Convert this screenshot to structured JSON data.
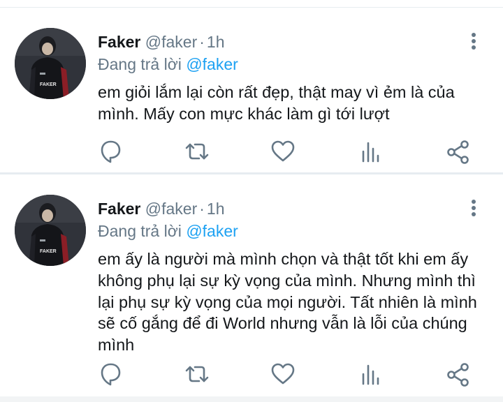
{
  "colors": {
    "name_text": "#14171a",
    "secondary_text": "#657786",
    "mention": "#1da1f2",
    "icon": "#657786",
    "divider": "#e6ecf0"
  },
  "tweets": [
    {
      "display_name": "Faker",
      "handle": "@faker",
      "separator_dot": "·",
      "time": "1h",
      "reply_prefix": "Đang trả lời ",
      "reply_to": "@faker",
      "text": "em giỏi lắm lại còn rất đẹp, thật may vì ẻm là của mình. Mấy con mực khác làm gì tới lượt",
      "avatar_jersey_text": "FAKER",
      "icons": {
        "avatar": "profile-avatar",
        "more": "more-vertical-icon",
        "reply": "reply-icon",
        "retweet": "retweet-icon",
        "like": "heart-icon",
        "stats": "analytics-icon",
        "share": "share-icon"
      }
    },
    {
      "display_name": "Faker",
      "handle": "@faker",
      "separator_dot": "·",
      "time": "1h",
      "reply_prefix": "Đang trả lời ",
      "reply_to": "@faker",
      "text": "em ấy là người mà mình chọn và thật tốt khi em ấy không phụ lại sự kỳ vọng của mình. Nhưng mình thì lại phụ sự kỳ vọng của mọi người. Tất nhiên là mình sẽ cố gắng để đi World nhưng vẫn là lỗi của chúng mình",
      "avatar_jersey_text": "FAKER",
      "icons": {
        "avatar": "profile-avatar",
        "more": "more-vertical-icon",
        "reply": "reply-icon",
        "retweet": "retweet-icon",
        "like": "heart-icon",
        "stats": "analytics-icon",
        "share": "share-icon"
      }
    }
  ]
}
